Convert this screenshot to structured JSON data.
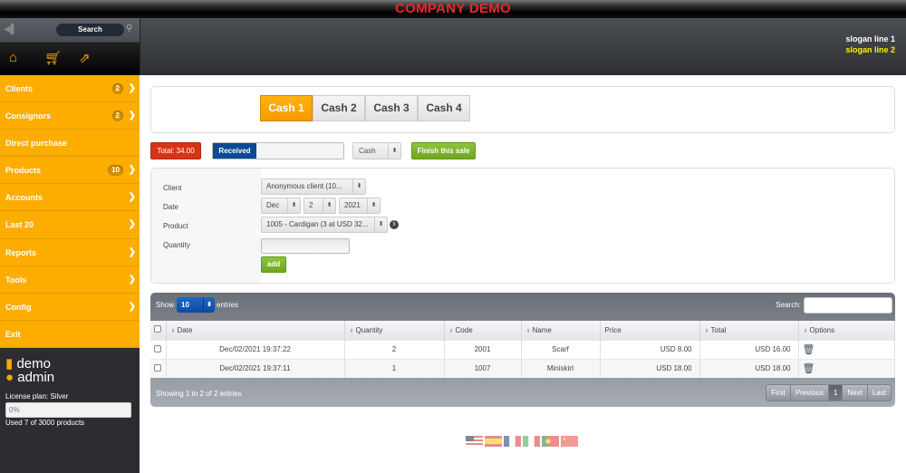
{
  "app": {
    "title": "COMPANY DEMO"
  },
  "header": {
    "slogan1": "slogan line 1",
    "slogan2": "slogan line 2",
    "slogan2_color": "#fff000"
  },
  "sidebar": {
    "search_label": "Search",
    "menu": [
      {
        "label": "Clients",
        "badge": "2",
        "chevron": true
      },
      {
        "label": "Consignors",
        "badge": "2",
        "chevron": true
      },
      {
        "label": "Direct purchase",
        "badge": null,
        "chevron": false
      },
      {
        "label": "Products",
        "badge": "10",
        "chevron": true
      },
      {
        "label": "Accounts",
        "badge": null,
        "chevron": true
      },
      {
        "label": "Last 20",
        "badge": null,
        "chevron": true
      },
      {
        "label": "Reports",
        "badge": null,
        "chevron": true
      },
      {
        "label": "Tools",
        "badge": null,
        "chevron": true
      },
      {
        "label": "Config",
        "badge": null,
        "chevron": true
      },
      {
        "label": "Exit",
        "badge": null,
        "chevron": false
      }
    ],
    "company": "demo",
    "user": "admin",
    "license": "License plan: Silver",
    "usage_percent": "0%",
    "usage_text": "Used 7 of 3000 products",
    "accent": "#fdad00"
  },
  "cash_tabs": [
    "Cash 1",
    "Cash 2",
    "Cash 3",
    "Cash 4"
  ],
  "actions": {
    "total": "Total: 34.00",
    "received_label": "Received",
    "received_value": "",
    "payment_method": "Cash",
    "finish": "Finish this sale"
  },
  "form": {
    "client_label": "Client",
    "client_value": "Anonymous client (10...",
    "date_label": "Date",
    "date_month": "Dec",
    "date_day": "2",
    "date_year": "2021",
    "product_label": "Product",
    "product_value": "1005 - Cardigan (3 at USD 32...",
    "quantity_label": "Quantity",
    "quantity_value": "",
    "add": "add"
  },
  "table": {
    "show": "Show",
    "length": "10",
    "entries": "entries",
    "search_label": "Search:",
    "columns": [
      "Date",
      "Quantity",
      "Code",
      "Name",
      "Price",
      "Total",
      "Options"
    ],
    "rows": [
      {
        "date": "Dec/02/2021 19:37:22",
        "quantity": "2",
        "code": "2001",
        "name": "Scarf",
        "price": "USD 8.00",
        "total": "USD 16.00"
      },
      {
        "date": "Dec/02/2021 19:37:11",
        "quantity": "1",
        "code": "1007",
        "name": "Miniskirt",
        "price": "USD 18.00",
        "total": "USD 18.00"
      }
    ],
    "info": "Showing 1 to 2 of 2 entries",
    "pager": [
      "First",
      "Previous",
      "1",
      "Next",
      "Last"
    ]
  },
  "languages": [
    "English",
    "Spanish",
    "French",
    "Italian",
    "Portuguese",
    "Chinese"
  ]
}
